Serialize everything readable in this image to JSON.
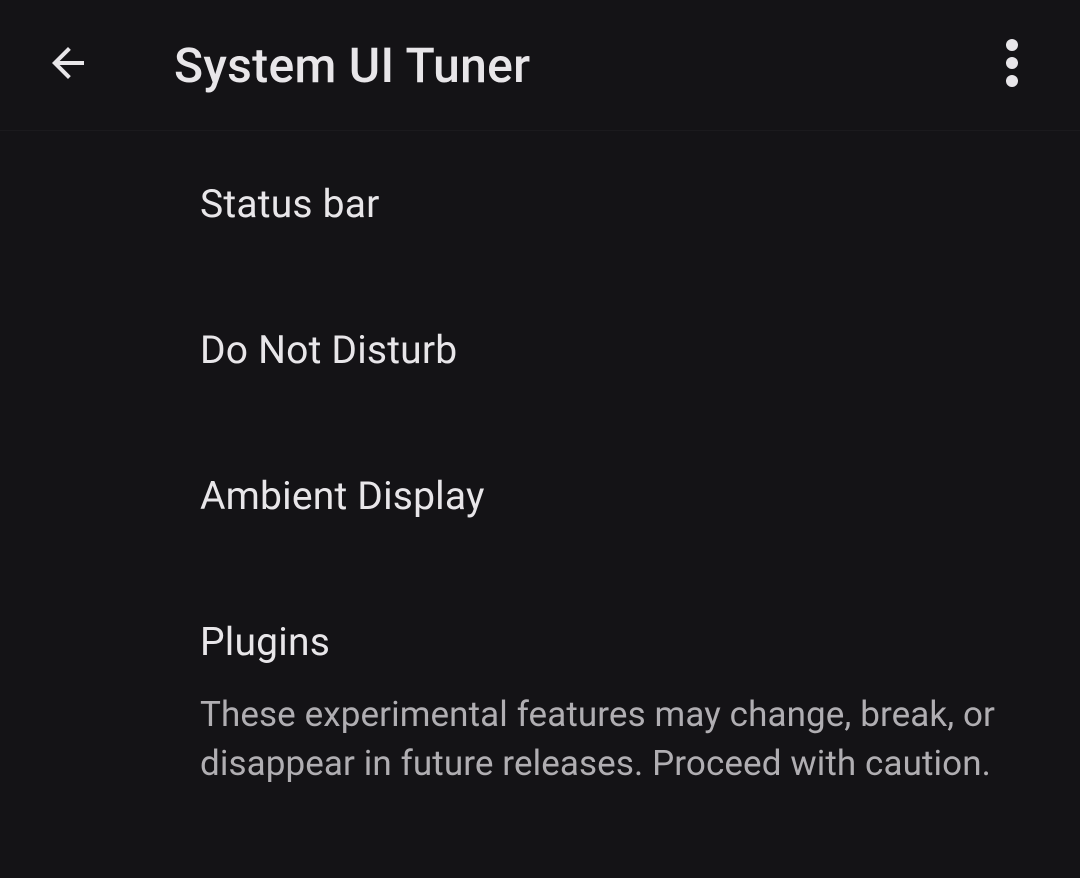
{
  "header": {
    "title": "System UI Tuner"
  },
  "items": [
    {
      "title": "Status bar"
    },
    {
      "title": "Do Not Disturb"
    },
    {
      "title": "Ambient Display"
    },
    {
      "title": "Plugins",
      "subtitle": "These experimental features may change, break, or disappear in future releases. Proceed with caution."
    }
  ]
}
